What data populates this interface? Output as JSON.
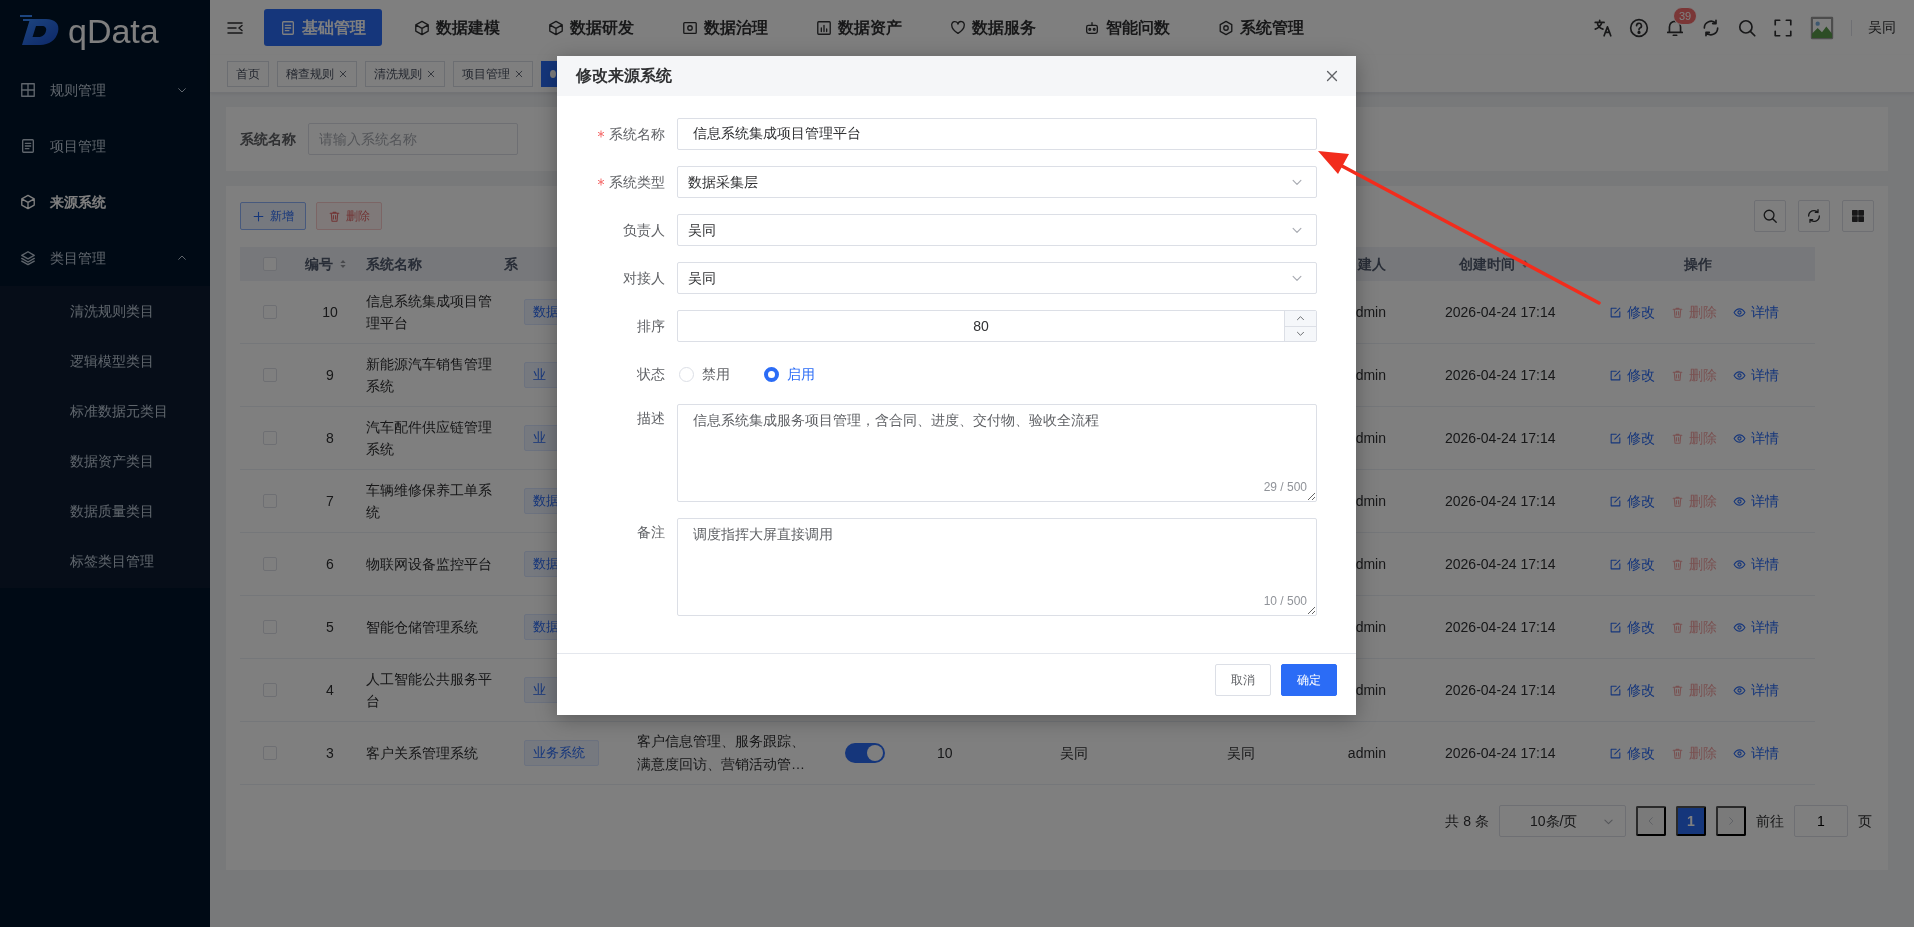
{
  "app": {
    "logo": "qData"
  },
  "sidebar": {
    "items": [
      {
        "kind": "group",
        "label": "规则管理",
        "selected": false,
        "expanded": false
      },
      {
        "kind": "link",
        "label": "项目管理",
        "selected": false
      },
      {
        "kind": "link",
        "label": "来源系统",
        "selected": true
      },
      {
        "kind": "group",
        "label": "类目管理",
        "selected": false,
        "expanded": true,
        "children": [
          {
            "label": "清洗规则类目",
            "selected": false
          },
          {
            "label": "逻辑模型类目",
            "selected": false
          },
          {
            "label": "标准数据元类目",
            "selected": false
          },
          {
            "label": "数据资产类目",
            "selected": false
          },
          {
            "label": "数据质量类目",
            "selected": false
          },
          {
            "label": "标签类目管理",
            "selected": false
          }
        ]
      }
    ]
  },
  "top_nav": [
    {
      "label": "基础管理",
      "selected": true
    },
    {
      "label": "数据建模",
      "selected": false
    },
    {
      "label": "数据研发",
      "selected": false
    },
    {
      "label": "数据治理",
      "selected": false
    },
    {
      "label": "数据资产",
      "selected": false
    },
    {
      "label": "数据服务",
      "selected": false
    },
    {
      "label": "智能问数",
      "selected": false
    },
    {
      "label": "系统管理",
      "selected": false
    }
  ],
  "header": {
    "notification_count": "39",
    "user_name": "吴同"
  },
  "page_tabs": [
    {
      "label": "首页",
      "closable": false,
      "selected": false
    },
    {
      "label": "稽查规则",
      "closable": true,
      "selected": false
    },
    {
      "label": "清洗规则",
      "closable": true,
      "selected": false
    },
    {
      "label": "项目管理",
      "closable": true,
      "selected": false
    },
    {
      "closable": false,
      "selected": true
    }
  ],
  "search_form": {
    "label": "系统名称",
    "placeholder": "请输入系统名称"
  },
  "toolbar": {
    "buttons": [
      {
        "kind": "add",
        "label": "新增",
        "disabled": false
      },
      {
        "kind": "delete",
        "label": "删除",
        "disabled": true
      }
    ]
  },
  "table": {
    "select_all_checked": false,
    "header": {
      "number": {
        "label": "编号",
        "sortable": true
      },
      "name": {
        "label": "系统名称",
        "sortable": false
      },
      "type": {
        "label": "系",
        "sortable": false
      },
      "creator": {
        "label": "建人",
        "sortable": false
      },
      "created_at": {
        "label": "创建时间",
        "sortable": true
      },
      "actions": {
        "label": "操作",
        "sortable": false
      }
    },
    "rows": [
      {
        "checked": false,
        "number": "10",
        "name": "信息系统集成项目管理平台",
        "type": "数据",
        "creator": "dmin",
        "created_at": "2026-04-24 17:14",
        "actions": [
          {
            "kind": "edit",
            "label": "修改",
            "disabled": false
          },
          {
            "kind": "delete",
            "label": "删除",
            "disabled": true
          },
          {
            "kind": "view",
            "label": "详情",
            "disabled": false
          }
        ]
      },
      {
        "checked": false,
        "number": "9",
        "name": "新能源汽车销售管理系统",
        "type": "业",
        "creator": "dmin",
        "created_at": "2026-04-24 17:14",
        "actions": [
          {
            "kind": "edit",
            "label": "修改",
            "disabled": false
          },
          {
            "kind": "delete",
            "label": "删除",
            "disabled": true
          },
          {
            "kind": "view",
            "label": "详情",
            "disabled": false
          }
        ]
      },
      {
        "checked": false,
        "number": "8",
        "name": "汽车配件供应链管理系统",
        "type": "业",
        "creator": "dmin",
        "created_at": "2026-04-24 17:14",
        "actions": [
          {
            "kind": "edit",
            "label": "修改",
            "disabled": false
          },
          {
            "kind": "delete",
            "label": "删除",
            "disabled": true
          },
          {
            "kind": "view",
            "label": "详情",
            "disabled": false
          }
        ]
      },
      {
        "checked": false,
        "number": "7",
        "name": "车辆维修保养工单系统",
        "type": "数据",
        "creator": "dmin",
        "created_at": "2026-04-24 17:14",
        "actions": [
          {
            "kind": "edit",
            "label": "修改",
            "disabled": false
          },
          {
            "kind": "delete",
            "label": "删除",
            "disabled": true
          },
          {
            "kind": "view",
            "label": "详情",
            "disabled": false
          }
        ]
      },
      {
        "checked": false,
        "number": "6",
        "name": "物联网设备监控平台",
        "type": "数据",
        "creator": "dmin",
        "created_at": "2026-04-24 17:14",
        "actions": [
          {
            "kind": "edit",
            "label": "修改",
            "disabled": false
          },
          {
            "kind": "delete",
            "label": "删除",
            "disabled": true
          },
          {
            "kind": "view",
            "label": "详情",
            "disabled": false
          }
        ]
      },
      {
        "checked": false,
        "number": "5",
        "name": "智能仓储管理系统",
        "type": "数据",
        "creator": "dmin",
        "created_at": "2026-04-24 17:14",
        "actions": [
          {
            "kind": "edit",
            "label": "修改",
            "disabled": false
          },
          {
            "kind": "delete",
            "label": "删除",
            "disabled": true
          },
          {
            "kind": "view",
            "label": "详情",
            "disabled": false
          }
        ]
      },
      {
        "checked": false,
        "number": "4",
        "name": "人工智能公共服务平台",
        "type": "业",
        "creator": "dmin",
        "created_at": "2026-04-24 17:14",
        "actions": [
          {
            "kind": "edit",
            "label": "修改",
            "disabled": false
          },
          {
            "kind": "delete",
            "label": "删除",
            "disabled": true
          },
          {
            "kind": "view",
            "label": "详情",
            "disabled": false
          }
        ]
      },
      {
        "checked": false,
        "number": "3",
        "name": "客户关系管理系统",
        "type": "业务系统",
        "description": "客户信息管理、服务跟踪、满意度回访、营销活动管…",
        "status_on": true,
        "sort": "10",
        "owner": "吴同",
        "contact": "吴同",
        "creator": "admin",
        "created_at": "2026-04-24 17:14",
        "actions": [
          {
            "kind": "edit",
            "label": "修改",
            "disabled": false
          },
          {
            "kind": "delete",
            "label": "删除",
            "disabled": true
          },
          {
            "kind": "view",
            "label": "详情",
            "disabled": false
          }
        ]
      }
    ]
  },
  "pagination": {
    "total": "共 8 条",
    "page_size": "10条/页",
    "pages": [
      {
        "label": "1",
        "selected": true
      }
    ],
    "goto_label": "前往",
    "goto_value": "1",
    "goto_suffix": "页"
  },
  "dialog": {
    "title": "修改来源系统",
    "fields": [
      {
        "kind": "text",
        "label": "系统名称",
        "required": true,
        "value": "信息系统集成项目管理平台"
      },
      {
        "kind": "select",
        "label": "系统类型",
        "required": true,
        "value": "数据采集层"
      },
      {
        "kind": "select",
        "label": "负责人",
        "required": false,
        "value": "吴同"
      },
      {
        "kind": "select",
        "label": "对接人",
        "required": false,
        "value": "吴同"
      },
      {
        "kind": "number",
        "label": "排序",
        "required": false,
        "value": "80"
      },
      {
        "kind": "radio",
        "label": "状态",
        "required": false,
        "options": [
          {
            "label": "禁用",
            "selected": false
          },
          {
            "label": "启用",
            "selected": true
          }
        ]
      },
      {
        "kind": "textarea",
        "label": "描述",
        "required": false,
        "value": "信息系统集成服务项目管理，含合同、进度、交付物、验收全流程",
        "counter": "29 / 500"
      },
      {
        "kind": "textarea",
        "label": "备注",
        "required": false,
        "value": "调度指挥大屏直接调用",
        "counter": "10 / 500"
      }
    ],
    "buttons": [
      {
        "label": "取消",
        "primary": false
      },
      {
        "label": "确定",
        "primary": true
      }
    ]
  }
}
